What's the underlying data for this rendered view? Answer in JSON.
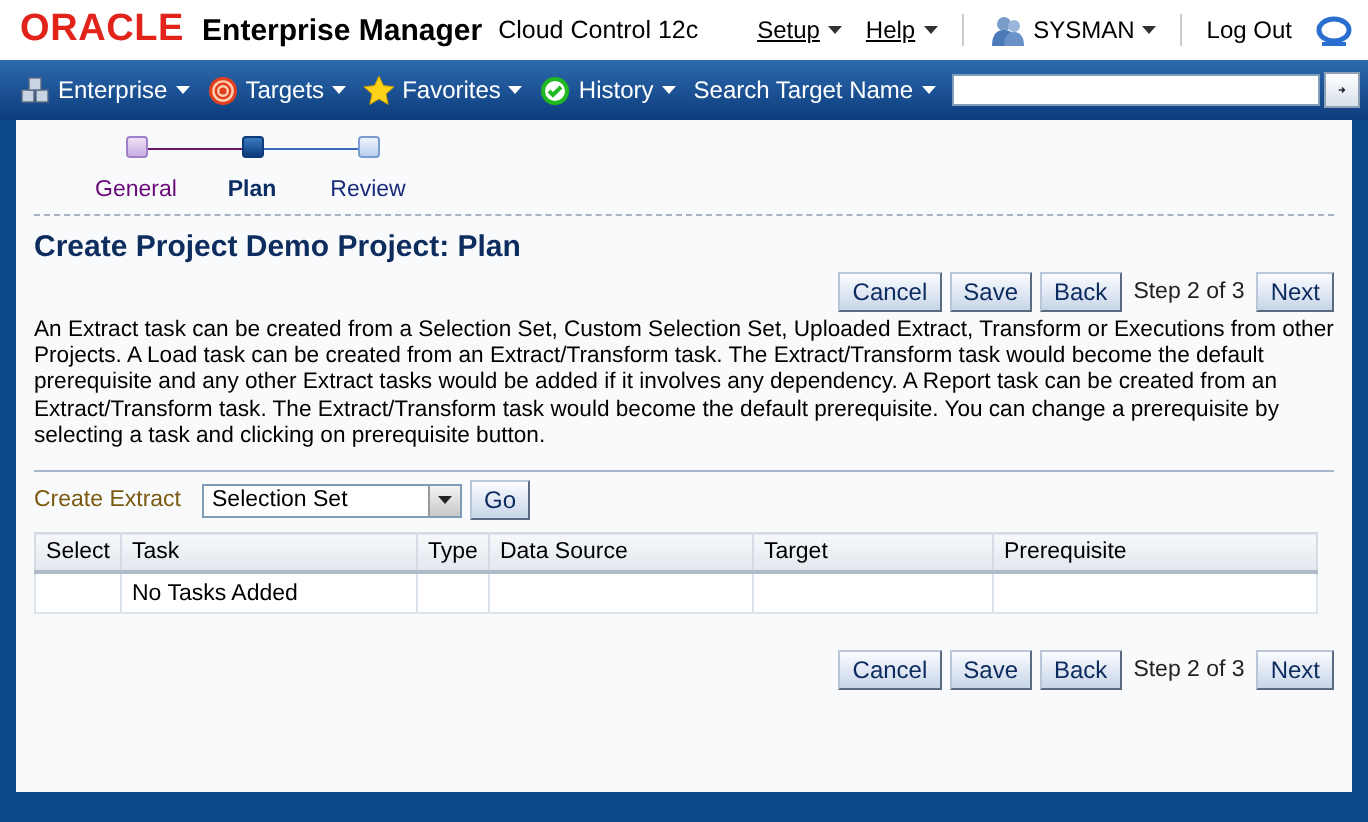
{
  "header": {
    "logo": "ORACLE",
    "product": "Enterprise Manager",
    "edition": "Cloud Control 12c",
    "menus": [
      {
        "label": "Setup"
      },
      {
        "label": "Help"
      }
    ],
    "user": "SYSMAN",
    "logout": "Log Out"
  },
  "nav": {
    "items": [
      {
        "label": "Enterprise",
        "kind": "cubes"
      },
      {
        "label": "Targets",
        "kind": "target"
      },
      {
        "label": "Favorites",
        "kind": "star"
      },
      {
        "label": "History",
        "kind": "check"
      }
    ],
    "search_label": "Search Target Name"
  },
  "train": [
    {
      "label": "General",
      "visited": true,
      "selected": false
    },
    {
      "label": "Plan",
      "visited": false,
      "selected": true
    },
    {
      "label": "Review",
      "visited": false,
      "selected": false
    }
  ],
  "title": "Create Project Demo Project: Plan",
  "top_buttons": {
    "cancel": "Cancel",
    "save": "Save",
    "back": "Back",
    "step": "Step 2 of 3",
    "next": "Next"
  },
  "description": "An Extract task can be created from a Selection Set, Custom Selection Set, Uploaded Extract, Transform or Executions from other Projects. A Load task can be created from an Extract/Transform task. The Extract/Transform task would become the default prerequisite and any other Extract tasks would be added if it involves any dependency. A Report task can be created from an Extract/Transform task. The Extract/Transform task would become the default prerequisite. You can change a prerequisite by selecting a task and clicking on prerequisite button.",
  "create_extract": {
    "label": "Create Extract",
    "value": "Selection Set",
    "go": "Go"
  },
  "table": {
    "columns": [
      "Select",
      "Task",
      "Type",
      "Data Source",
      "Target",
      "Prerequisite"
    ],
    "rows": [
      [
        "",
        "No Tasks Added",
        "",
        "",
        "",
        ""
      ]
    ]
  },
  "bottom_buttons": {
    "cancel": "Cancel",
    "save": "Save",
    "back": "Back",
    "step": "Step 2 of 3",
    "next": "Next"
  }
}
